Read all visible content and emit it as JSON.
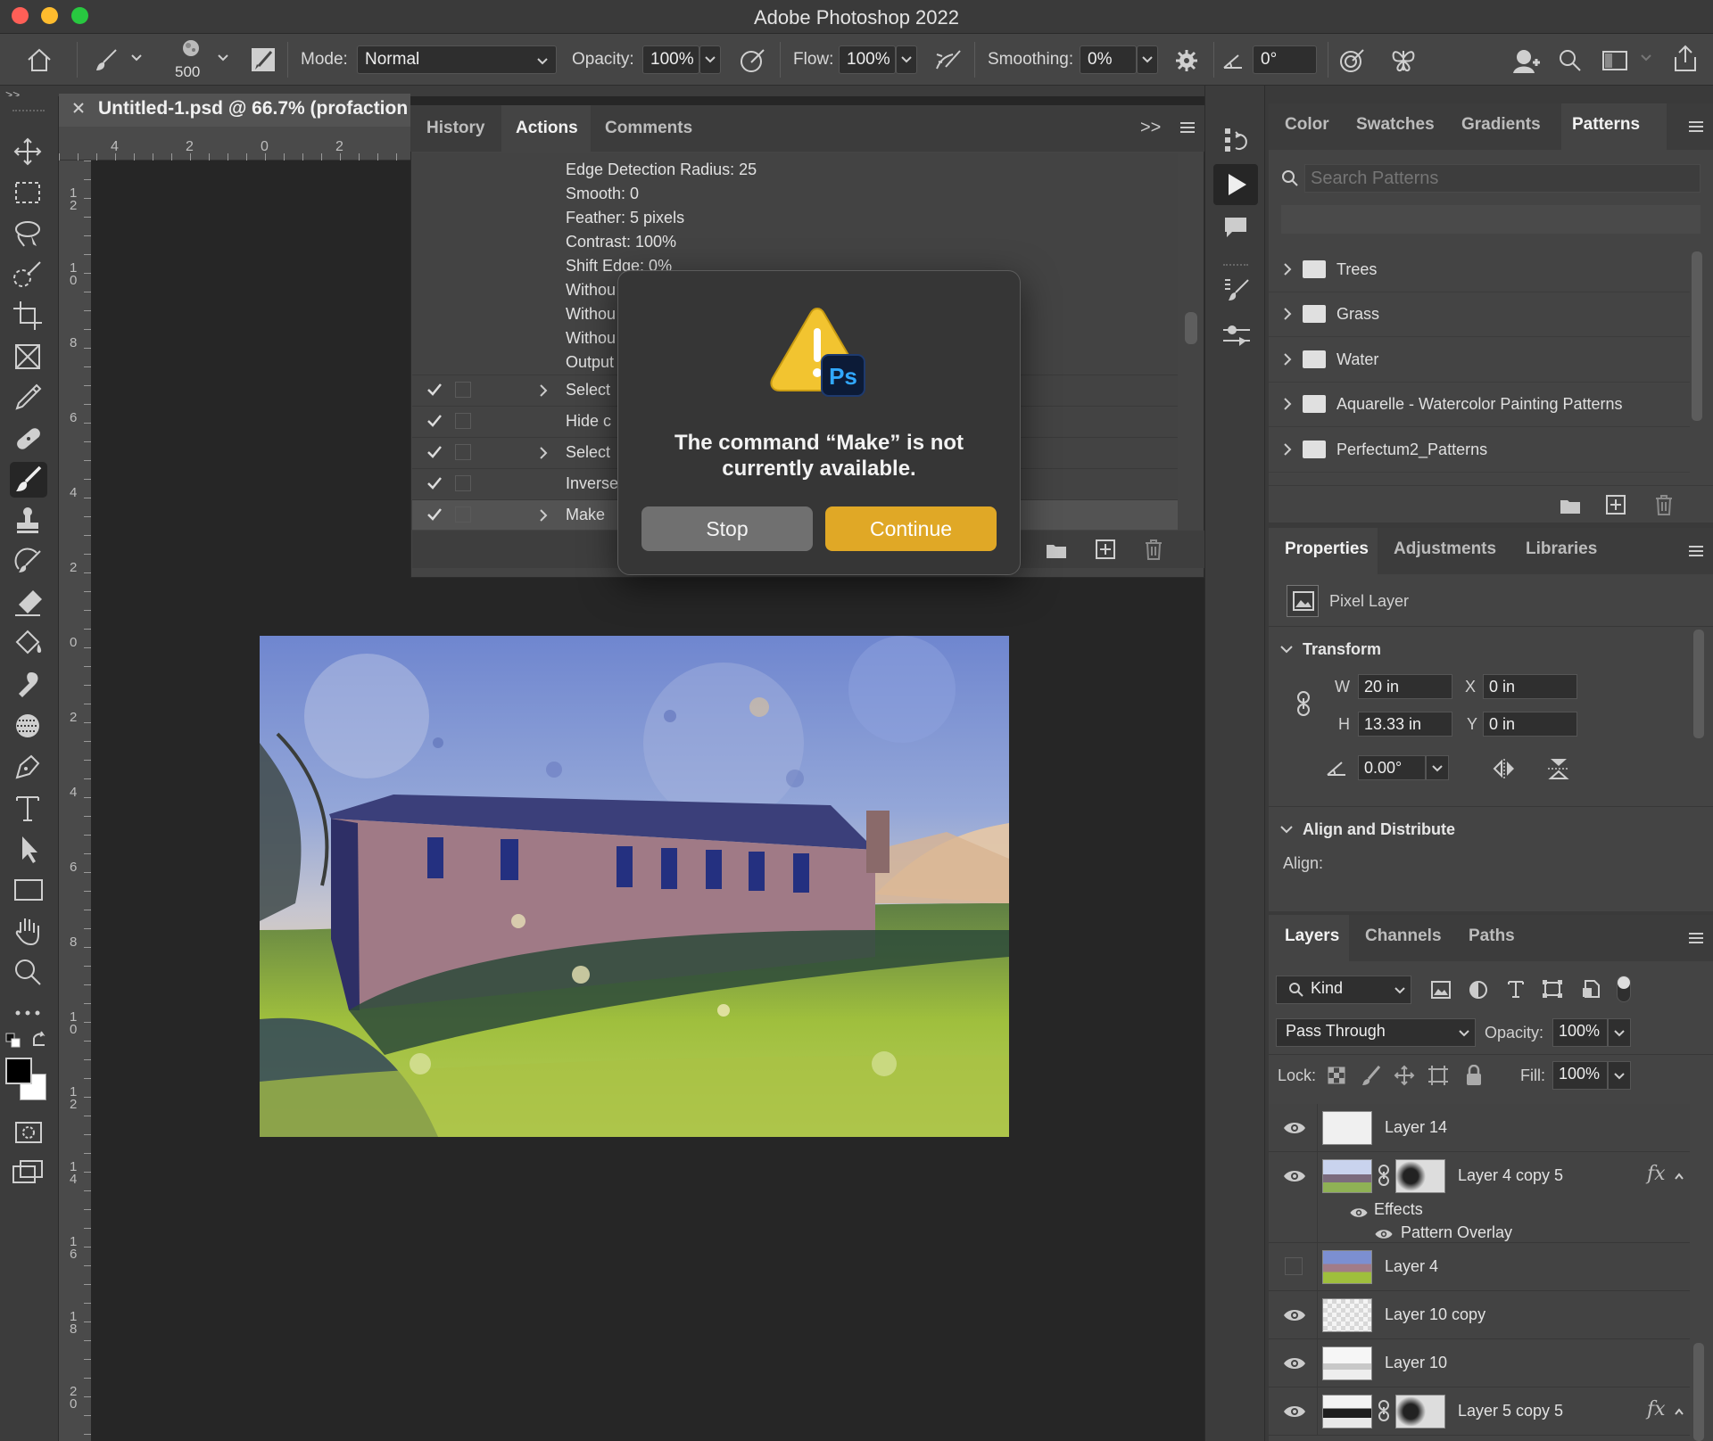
{
  "window": {
    "title": "Adobe Photoshop 2022"
  },
  "options_bar": {
    "brush_size": "500",
    "mode_label": "Mode:",
    "mode_value": "Normal",
    "opacity_label": "Opacity:",
    "opacity_value": "100%",
    "flow_label": "Flow:",
    "flow_value": "100%",
    "smoothing_label": "Smoothing:",
    "smoothing_value": "0%",
    "angle_value": "0°"
  },
  "document": {
    "tab_title": "Untitled-1.psd @ 66.7% (profaction",
    "ruler_top": [
      "4",
      "2",
      "0",
      "2"
    ],
    "ruler_left": [
      "1\n2",
      "1\n0",
      "8",
      "6",
      "4",
      "2",
      "0",
      "2",
      "4",
      "6",
      "8",
      "1\n0",
      "1\n2",
      "1\n4",
      "1\n6",
      "1\n8",
      "2\n0"
    ]
  },
  "actions_panel": {
    "tabs": [
      "History",
      "Actions",
      "Comments"
    ],
    "detail_lines": [
      "Edge Detection Radius: 25",
      "Smooth: 0",
      "Feather: 5 pixels",
      "Contrast: 100%",
      "Shift Edge: 0%",
      "Withou",
      "Withou",
      "Withou",
      "Output"
    ],
    "rows": [
      {
        "label": "Select",
        "expandable": true
      },
      {
        "label": "Hide c",
        "expandable": false
      },
      {
        "label": "Select",
        "expandable": true
      },
      {
        "label": "Inverse",
        "expandable": false
      },
      {
        "label": "Make",
        "expandable": true
      }
    ]
  },
  "dialog": {
    "message_line1": "The command “Make” is not",
    "message_line2": "currently available.",
    "stop_label": "Stop",
    "continue_label": "Continue",
    "badge": "Ps"
  },
  "patterns_panel": {
    "tabs": [
      "Color",
      "Swatches",
      "Gradients",
      "Patterns"
    ],
    "search_placeholder": "Search Patterns",
    "folders": [
      "Trees",
      "Grass",
      "Water",
      "Aquarelle - Watercolor Painting Patterns",
      "Perfectum2_Patterns"
    ]
  },
  "properties_panel": {
    "tabs": [
      "Properties",
      "Adjustments",
      "Libraries"
    ],
    "layer_type": "Pixel Layer",
    "transform_header": "Transform",
    "w_label": "W",
    "w_value": "20 in",
    "h_label": "H",
    "h_value": "13.33 in",
    "x_label": "X",
    "x_value": "0 in",
    "y_label": "Y",
    "y_value": "0 in",
    "angle_value": "0.00°",
    "align_header": "Align and Distribute",
    "align_label": "Align:"
  },
  "layers_panel": {
    "tabs": [
      "Layers",
      "Channels",
      "Paths"
    ],
    "filter_kind": "Kind",
    "blend_mode": "Pass Through",
    "opacity_label": "Opacity:",
    "opacity_value": "100%",
    "lock_label": "Lock:",
    "fill_label": "Fill:",
    "fill_value": "100%",
    "layers": [
      {
        "name": "Layer 14"
      },
      {
        "name": "Layer 4 copy 5",
        "fx": "fx"
      },
      {
        "name": "Layer 4"
      },
      {
        "name": "Layer 10 copy"
      },
      {
        "name": "Layer 10"
      },
      {
        "name": "Layer 5 copy 5",
        "fx": "fx"
      }
    ],
    "effects_label": "Effects",
    "pattern_overlay_label": "Pattern Overlay"
  },
  "colors": {
    "accent_continue": "#e0a826",
    "stop_button": "#707070",
    "panel_bg": "#444444"
  }
}
